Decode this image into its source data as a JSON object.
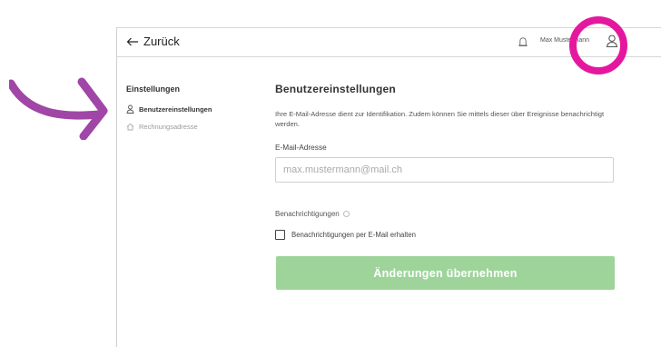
{
  "header": {
    "back_label": "Zurück",
    "user_name": "Max Mustermann"
  },
  "sidebar": {
    "title": "Einstellungen",
    "items": [
      {
        "label": "Benutzereinstellungen",
        "icon": "user-icon",
        "active": true
      },
      {
        "label": "Rechnungsadresse",
        "icon": "home-icon",
        "active": false
      }
    ]
  },
  "main": {
    "title": "Benutzereinstellungen",
    "description": "Ihre E-Mail-Adresse dient zur Identifikation. Zudem können Sie mittels dieser über Ereignisse benachrichtigt werden.",
    "email": {
      "label": "E-Mail-Adresse",
      "placeholder": "max.mustermann@mail.ch",
      "value": ""
    },
    "notifications": {
      "label": "Benachrichtigungen",
      "checkbox_label": "Benachrichtigungen per E-Mail erhalten",
      "checked": false
    },
    "submit_label": "Änderungen übernehmen"
  },
  "colors": {
    "button": "#9ed49a",
    "annotation_arrow": "#a046a6",
    "annotation_circle": "#e4189f"
  }
}
